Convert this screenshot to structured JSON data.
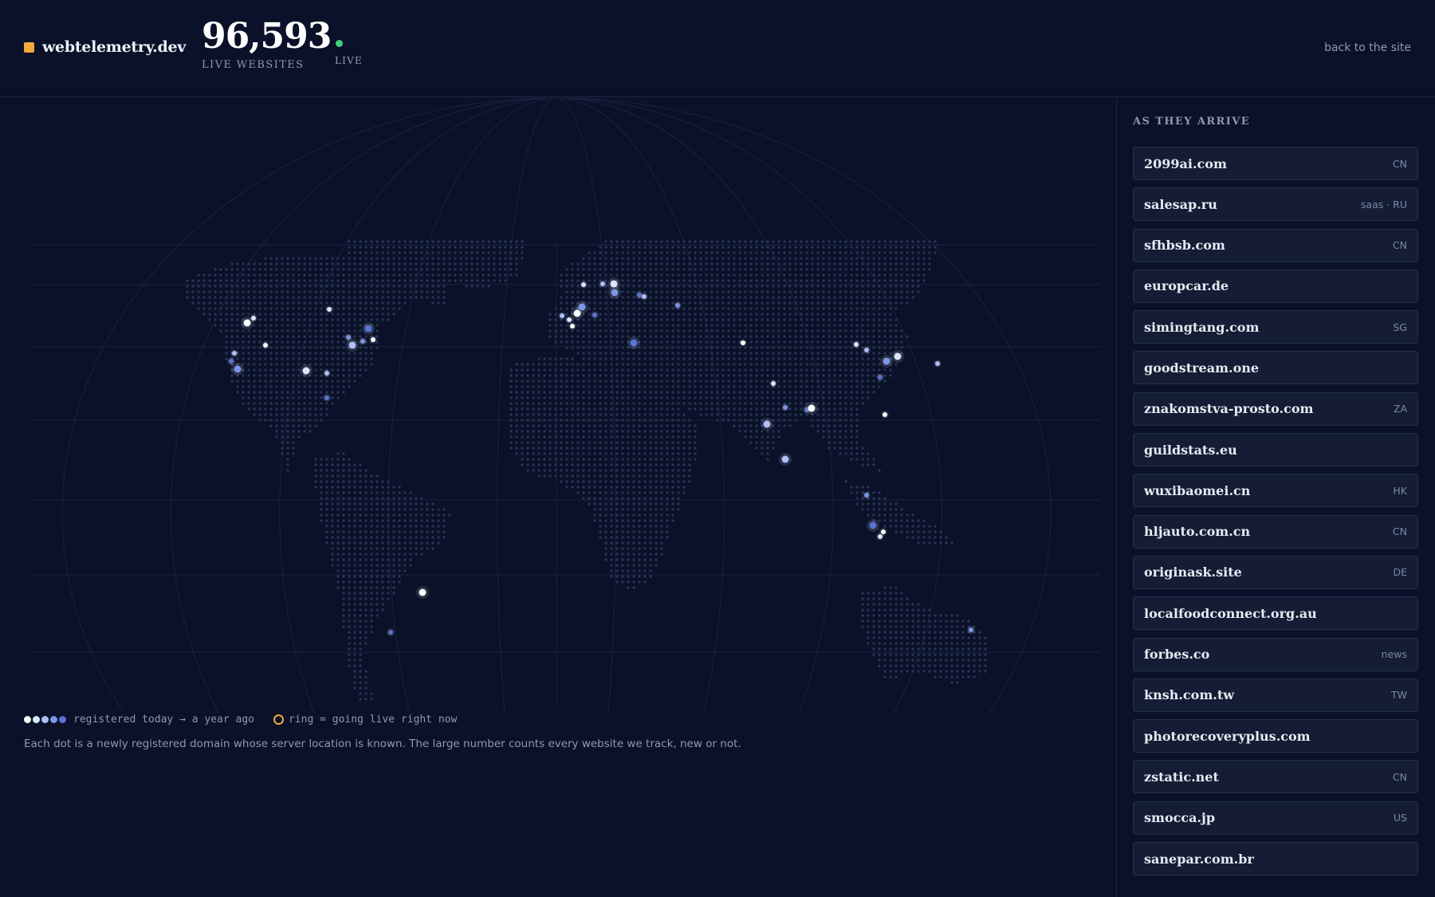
{
  "header": {
    "brand": "webtelemetry.dev",
    "stat_value": "96,593",
    "stat_label": "LIVE WEBSITES",
    "live_label": "LIVE",
    "back_link": "back to the site"
  },
  "colors": {
    "accent": "#f4a93a",
    "live": "#3ed07c",
    "background": "#0a1128",
    "dot_age_scale": [
      "#ffffff",
      "#dbe5ff",
      "#aebff5",
      "#7d95e6",
      "#5874d4"
    ]
  },
  "legend": {
    "age_text": "registered today → a year ago",
    "ring_text": "ring = going live right now"
  },
  "caption": "Each dot is a newly registered domain whose server location is known. The large number counts every website we track, new or not.",
  "sidebar": {
    "title": "AS THEY ARRIVE",
    "feed": [
      {
        "domain": "2099ai.com",
        "tag": "CN"
      },
      {
        "domain": "salesap.ru",
        "tag": "saas · RU"
      },
      {
        "domain": "sfhbsb.com",
        "tag": "CN"
      },
      {
        "domain": "europcar.de",
        "tag": ""
      },
      {
        "domain": "simingtang.com",
        "tag": "SG"
      },
      {
        "domain": "goodstream.one",
        "tag": ""
      },
      {
        "domain": "znakomstva-prosto.com",
        "tag": "ZA"
      },
      {
        "domain": "guildstats.eu",
        "tag": ""
      },
      {
        "domain": "wuxibaomei.cn",
        "tag": "HK"
      },
      {
        "domain": "hljauto.com.cn",
        "tag": "CN"
      },
      {
        "domain": "originask.site",
        "tag": "DE"
      },
      {
        "domain": "localfoodconnect.org.au",
        "tag": ""
      },
      {
        "domain": "forbes.co",
        "tag": "news"
      },
      {
        "domain": "knsh.com.tw",
        "tag": "TW"
      },
      {
        "domain": "photorecoveryplus.com",
        "tag": ""
      },
      {
        "domain": "zstatic.net",
        "tag": "CN"
      },
      {
        "domain": "smocca.jp",
        "tag": "US"
      },
      {
        "domain": "sanepar.com.br",
        "tag": ""
      }
    ]
  }
}
